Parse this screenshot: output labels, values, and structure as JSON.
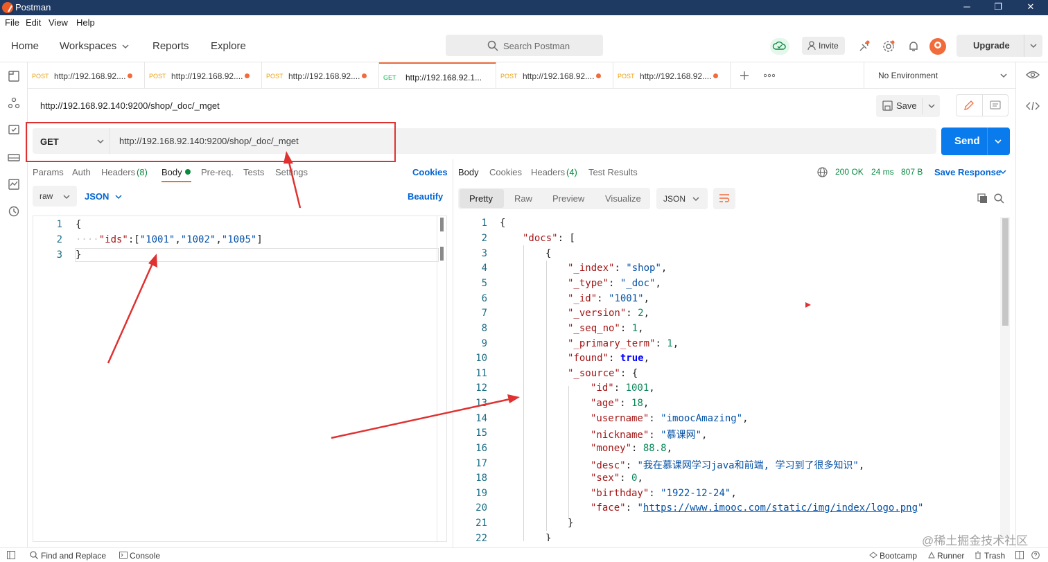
{
  "window": {
    "title": "Postman",
    "minimize": "─",
    "restore": "❐",
    "close": "✕"
  },
  "menu": [
    "File",
    "Edit",
    "View",
    "Help"
  ],
  "header": {
    "nav": [
      "Home",
      "Workspaces",
      "Reports",
      "Explore"
    ],
    "search_placeholder": "Search Postman",
    "invite": "Invite",
    "upgrade": "Upgrade"
  },
  "tabs": [
    {
      "method": "POST",
      "url": "http://192.168.92....",
      "method_color": "#e8a317"
    },
    {
      "method": "POST",
      "url": "http://192.168.92....",
      "method_color": "#e8a317"
    },
    {
      "method": "POST",
      "url": "http://192.168.92....",
      "method_color": "#e8a317"
    },
    {
      "method": "GET",
      "url": "http://192.168.92.1...",
      "method_color": "#0cbb52"
    },
    {
      "method": "POST",
      "url": "http://192.168.92....",
      "method_color": "#e8a317"
    },
    {
      "method": "POST",
      "url": "http://192.168.92....",
      "method_color": "#e8a317"
    }
  ],
  "environment": "No Environment",
  "request": {
    "name": "http://192.168.92.140:9200/shop/_doc/_mget",
    "save": "Save",
    "method": "GET",
    "url": "http://192.168.92.140:9200/shop/_doc/_mget",
    "send": "Send",
    "tabs": {
      "params": "Params",
      "auth": "Auth",
      "headers": "Headers",
      "headers_count": "(8)",
      "body": "Body",
      "prereq": "Pre-req.",
      "tests": "Tests",
      "settings": "Settings"
    },
    "cookies": "Cookies",
    "body_mode": "raw",
    "body_lang": "JSON",
    "beautify": "Beautify",
    "body_lines": [
      "1",
      "2",
      "3"
    ]
  },
  "response": {
    "tabs": {
      "body": "Body",
      "cookies": "Cookies",
      "headers": "Headers",
      "headers_count": "(4)",
      "tests": "Test Results"
    },
    "status": "200 OK",
    "time": "24 ms",
    "size": "807 B",
    "save_response": "Save Response",
    "views": [
      "Pretty",
      "Raw",
      "Preview",
      "Visualize"
    ],
    "format": "JSON",
    "line_numbers": [
      "1",
      "2",
      "3",
      "4",
      "5",
      "6",
      "7",
      "8",
      "9",
      "10",
      "11",
      "12",
      "13",
      "14",
      "15",
      "16",
      "17",
      "18",
      "19",
      "20",
      "21",
      "22"
    ],
    "json": {
      "docs_key": "\"docs\"",
      "index_key": "\"_index\"",
      "index_val": "\"shop\"",
      "type_key": "\"_type\"",
      "type_val": "\"_doc\"",
      "id_key": "\"_id\"",
      "id_val": "\"1001\"",
      "version_key": "\"_version\"",
      "version_val": "2",
      "seq_key": "\"_seq_no\"",
      "seq_val": "1",
      "primary_key": "\"_primary_term\"",
      "primary_val": "1",
      "found_key": "\"found\"",
      "found_val": "true",
      "source_key": "\"_source\"",
      "sid_key": "\"id\"",
      "sid_val": "1001",
      "age_key": "\"age\"",
      "age_val": "18",
      "username_key": "\"username\"",
      "username_val": "\"imoocAmazing\"",
      "nickname_key": "\"nickname\"",
      "nickname_val": "\"慕课网\"",
      "money_key": "\"money\"",
      "money_val": "88.8",
      "desc_key": "\"desc\"",
      "desc_val": "\"我在慕课网学习java和前端, 学习到了很多知识\"",
      "sex_key": "\"sex\"",
      "sex_val": "0",
      "birthday_key": "\"birthday\"",
      "birthday_val": "\"1922-12-24\"",
      "face_key": "\"face\"",
      "face_url": "https://www.imooc.com/static/img/index/logo.png"
    }
  },
  "statusbar": {
    "find_replace": "Find and Replace",
    "console": "Console",
    "bootcamp": "Bootcamp",
    "runner": "Runner",
    "trash": "Trash"
  },
  "watermark": "@稀土掘金技术社区",
  "colors": {
    "accent": "#f26b3a",
    "send": "#097bed",
    "link": "#0265d2",
    "annotation": "#e03131"
  }
}
